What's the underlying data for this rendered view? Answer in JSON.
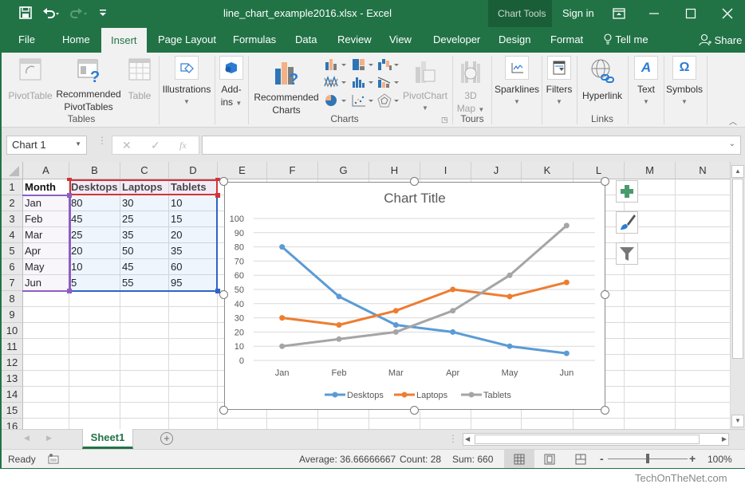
{
  "window": {
    "title": "line_chart_example2016.xlsx - Excel",
    "context_tool_label": "Chart Tools",
    "sign_in": "Sign in"
  },
  "tabs": [
    {
      "label": "File"
    },
    {
      "label": "Home"
    },
    {
      "label": "Insert",
      "active": true
    },
    {
      "label": "Page Layout"
    },
    {
      "label": "Formulas"
    },
    {
      "label": "Data"
    },
    {
      "label": "Review"
    },
    {
      "label": "View"
    },
    {
      "label": "Developer"
    },
    {
      "label": "Design"
    },
    {
      "label": "Format"
    },
    {
      "label": "Tell me"
    },
    {
      "label": "Share"
    }
  ],
  "ribbon": {
    "groups": {
      "tables": "Tables",
      "charts": "Charts",
      "tours": "Tours",
      "links": "Links"
    },
    "buttons": {
      "pivottable": "PivotTable",
      "recommended_pivottables_1": "Recommended",
      "recommended_pivottables_2": "PivotTables",
      "table": "Table",
      "illustrations": "Illustrations",
      "addins_1": "Add-",
      "addins_2": "ins",
      "recommended_charts_1": "Recommended",
      "recommended_charts_2": "Charts",
      "pivotchart": "PivotChart",
      "map3d_1": "3D",
      "map3d_2": "Map",
      "sparklines": "Sparklines",
      "filters": "Filters",
      "hyperlink": "Hyperlink",
      "text": "Text",
      "symbols": "Symbols"
    }
  },
  "formula_bar": {
    "name_box": "Chart 1",
    "formula": "",
    "fx": "fx"
  },
  "columns": [
    "A",
    "B",
    "C",
    "D",
    "E",
    "F",
    "G",
    "H",
    "I",
    "J",
    "K",
    "L",
    "M",
    "N"
  ],
  "rows": [
    "1",
    "2",
    "3",
    "4",
    "5",
    "6",
    "7",
    "8",
    "9",
    "10",
    "11",
    "12",
    "13",
    "14",
    "15",
    "16"
  ],
  "cells": [
    [
      "Month",
      "Desktops",
      "Laptops",
      "Tablets"
    ],
    [
      "Jan",
      "80",
      "30",
      "10"
    ],
    [
      "Feb",
      "45",
      "25",
      "15"
    ],
    [
      "Mar",
      "25",
      "35",
      "20"
    ],
    [
      "Apr",
      "20",
      "50",
      "35"
    ],
    [
      "May",
      "10",
      "45",
      "60"
    ],
    [
      "Jun",
      "5",
      "55",
      "95"
    ]
  ],
  "sheets": [
    {
      "label": "Sheet1",
      "active": true
    }
  ],
  "status": {
    "ready": "Ready",
    "average": "Average: 36.66666667",
    "count": "Count: 28",
    "sum": "Sum: 660",
    "zoom": "100%",
    "zoom_minus": "-",
    "zoom_plus": "+",
    "zoom_fraction": 0.5
  },
  "watermark": "TechOnTheNet.com",
  "colors": {
    "excel_green": "#217346",
    "desktops": "#5b9bd5",
    "laptops": "#ed7d31",
    "tablets": "#a5a5a5"
  },
  "chart_data": {
    "type": "line",
    "title": "Chart Title",
    "categories": [
      "Jan",
      "Feb",
      "Mar",
      "Apr",
      "May",
      "Jun"
    ],
    "series": [
      {
        "name": "Desktops",
        "color": "#5b9bd5",
        "values": [
          80,
          45,
          25,
          20,
          10,
          5
        ]
      },
      {
        "name": "Laptops",
        "color": "#ed7d31",
        "values": [
          30,
          25,
          35,
          50,
          45,
          55
        ]
      },
      {
        "name": "Tablets",
        "color": "#a5a5a5",
        "values": [
          10,
          15,
          20,
          35,
          60,
          95
        ]
      }
    ],
    "yticks": [
      "0",
      "10",
      "20",
      "30",
      "40",
      "50",
      "60",
      "70",
      "80",
      "90",
      "100"
    ],
    "ylim": [
      0,
      100
    ],
    "xlabel": "",
    "ylabel": "",
    "grid": true,
    "legend": "bottom"
  }
}
